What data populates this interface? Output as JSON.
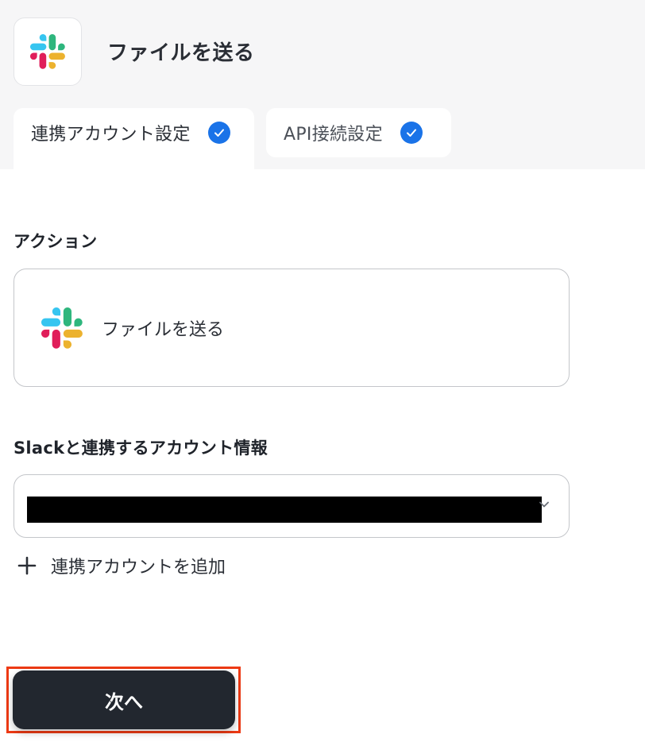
{
  "header": {
    "title": "ファイルを送る",
    "app_icon": "slack-logo-icon"
  },
  "tabs": [
    {
      "label": "連携アカウント設定",
      "active": true,
      "completed": true
    },
    {
      "label": "API接続設定",
      "active": false,
      "completed": true
    }
  ],
  "action_section": {
    "label": "アクション",
    "selected_action": "ファイルを送る",
    "icon": "slack-logo-icon"
  },
  "account_section": {
    "label": "Slackと連携するアカウント情報",
    "selected_value_redacted": true,
    "add_account_label": "連携アカウントを追加"
  },
  "footer": {
    "next_label": "次へ",
    "highlight_color": "#ee3a14"
  },
  "colors": {
    "check_blue": "#1a73e8",
    "button_dark": "#22272f",
    "slack_blue": "#36c5f0",
    "slack_green": "#2eb67d",
    "slack_yellow": "#ecb22e",
    "slack_red": "#e01e5a"
  }
}
